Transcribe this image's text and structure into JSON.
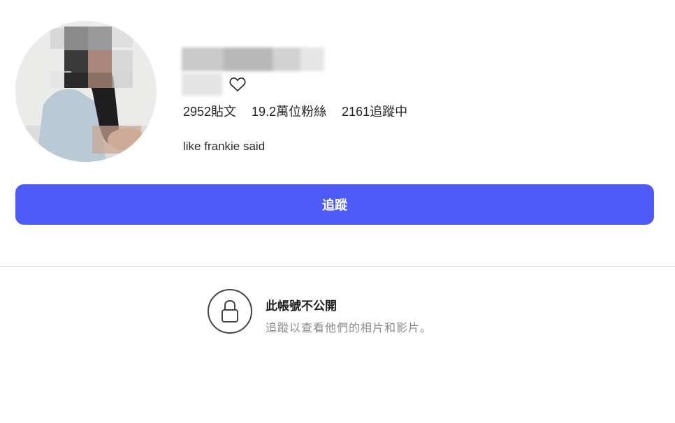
{
  "profile": {
    "stats": {
      "posts": "2952貼文",
      "followers": "19.2萬位粉絲",
      "following": "2161追蹤中"
    },
    "bio": "like frankie said",
    "avatar_icon": "profile-photo-pixelated",
    "heart_icon": "heart-outline-icon"
  },
  "follow_button": {
    "label": "追蹤",
    "color": "#4f5bf7"
  },
  "private_notice": {
    "title": "此帳號不公開",
    "subtitle": "追蹤以查看他們的相片和影片。",
    "icon": "lock-icon"
  }
}
